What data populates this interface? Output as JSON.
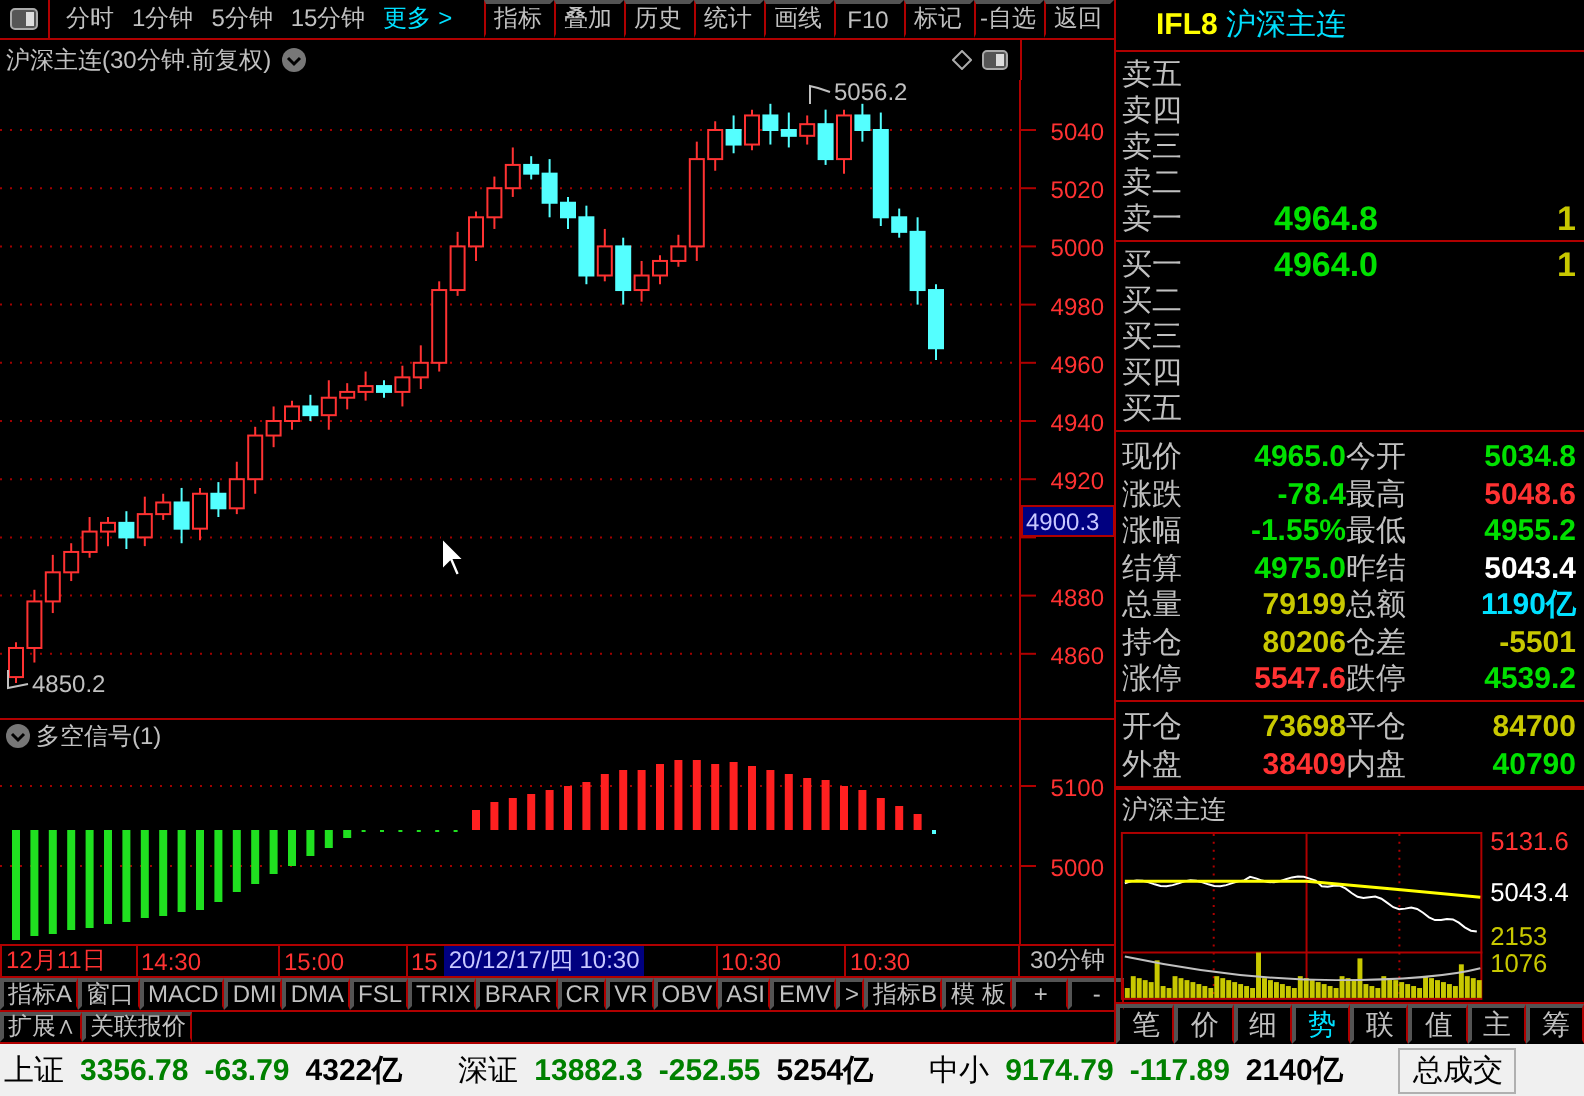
{
  "toolbar": {
    "periods": [
      "分时",
      "1分钟",
      "5分钟",
      "15分钟"
    ],
    "more": "更多 >",
    "tools": [
      "指标",
      "叠加",
      "历史",
      "统计",
      "画线",
      "F10",
      "标记",
      "-自选",
      "返回"
    ]
  },
  "chart": {
    "title": "沪深主连(30分钟.前复权)",
    "y_labels": [
      "5040",
      "5020",
      "5000",
      "4980",
      "4960",
      "4940",
      "4920",
      "4880",
      "4860"
    ],
    "high_label": "5056.2",
    "low_label": "4850.2",
    "cursor_price": "4900.3"
  },
  "indicator": {
    "title": "多空信号(1)",
    "y_labels": [
      "5100",
      "5000"
    ]
  },
  "x_axis": {
    "labels": [
      "12月11日",
      "14:30",
      "15:00",
      "15"
    ],
    "cursor_time": "20/12/17/四 10:30",
    "labels_after": [
      "10:30",
      "10:30"
    ],
    "period": "30分钟"
  },
  "indicator_tabs": [
    "指标A",
    "窗口",
    "MACD",
    "DMI",
    "DMA",
    "FSL",
    "TRIX",
    "BRAR",
    "CR",
    "VR",
    "OBV",
    "ASI",
    "EMV",
    ">",
    "指标B",
    "模 板",
    "+",
    "-"
  ],
  "extension_tabs": [
    "扩展∧",
    "关联报价"
  ],
  "quote": {
    "code": "IFL8",
    "name": "沪深主连",
    "asks": [
      {
        "label": "卖五"
      },
      {
        "label": "卖四"
      },
      {
        "label": "卖三"
      },
      {
        "label": "卖二"
      },
      {
        "label": "卖一",
        "price": "4964.8",
        "volume": "1"
      }
    ],
    "bids": [
      {
        "label": "买一",
        "price": "4964.0",
        "volume": "1"
      },
      {
        "label": "买二"
      },
      {
        "label": "买三"
      },
      {
        "label": "买四"
      },
      {
        "label": "买五"
      }
    ],
    "stats": [
      {
        "label": "现价",
        "value": "4965.0",
        "color": "#00e000"
      },
      {
        "label": "今开",
        "value": "5034.8",
        "color": "#00e000"
      },
      {
        "label": "涨跌",
        "value": "-78.4",
        "color": "#00e000"
      },
      {
        "label": "最高",
        "value": "5048.6",
        "color": "#ff3232"
      },
      {
        "label": "涨幅",
        "value": "-1.55%",
        "color": "#00e000"
      },
      {
        "label": "最低",
        "value": "4955.2",
        "color": "#00e000"
      },
      {
        "label": "结算",
        "value": "4975.0",
        "color": "#00e000"
      },
      {
        "label": "昨结",
        "value": "5043.4",
        "color": "#ffffff"
      },
      {
        "label": "总量",
        "value": "79199",
        "color": "#c8c800"
      },
      {
        "label": "总额",
        "value": "1190亿",
        "color": "#00e0ff"
      },
      {
        "label": "持仓",
        "value": "80206",
        "color": "#c8c800"
      },
      {
        "label": "仓差",
        "value": "-5501",
        "color": "#c8c800"
      },
      {
        "label": "涨停",
        "value": "5547.6",
        "color": "#ff3232"
      },
      {
        "label": "跌停",
        "value": "4539.2",
        "color": "#00e000"
      }
    ],
    "flows": [
      {
        "label": "开仓",
        "value": "73698",
        "color": "#c8c800"
      },
      {
        "label": "平仓",
        "value": "84700",
        "color": "#c8c800"
      },
      {
        "label": "外盘",
        "value": "38409",
        "color": "#ff3232"
      },
      {
        "label": "内盘",
        "value": "40790",
        "color": "#00e000"
      }
    ],
    "mini_chart": {
      "title": "沪深主连",
      "labels": [
        {
          "text": "5131.6",
          "color": "#ff3232"
        },
        {
          "text": "5043.4",
          "color": "#ffffff"
        },
        {
          "text": "2153",
          "color": "#c8c800"
        },
        {
          "text": "1076",
          "color": "#c8c800"
        }
      ]
    },
    "tabs": [
      {
        "label": "笔",
        "selected": false
      },
      {
        "label": "价",
        "selected": false
      },
      {
        "label": "细",
        "selected": false
      },
      {
        "label": "势",
        "selected": true
      },
      {
        "label": "联",
        "selected": false
      },
      {
        "label": "值",
        "selected": false
      },
      {
        "label": "主",
        "selected": false
      },
      {
        "label": "筹",
        "selected": false
      }
    ]
  },
  "status_bar": {
    "markets": [
      {
        "name": "上证",
        "price": "3356.78",
        "change": "-63.79",
        "amount": "4322亿"
      },
      {
        "name": "深证",
        "price": "13882.3",
        "change": "-252.55",
        "amount": "5254亿"
      },
      {
        "name": "中小",
        "price": "9174.79",
        "change": "-117.89",
        "amount": "2140亿"
      }
    ],
    "total_label": "总成交"
  }
}
